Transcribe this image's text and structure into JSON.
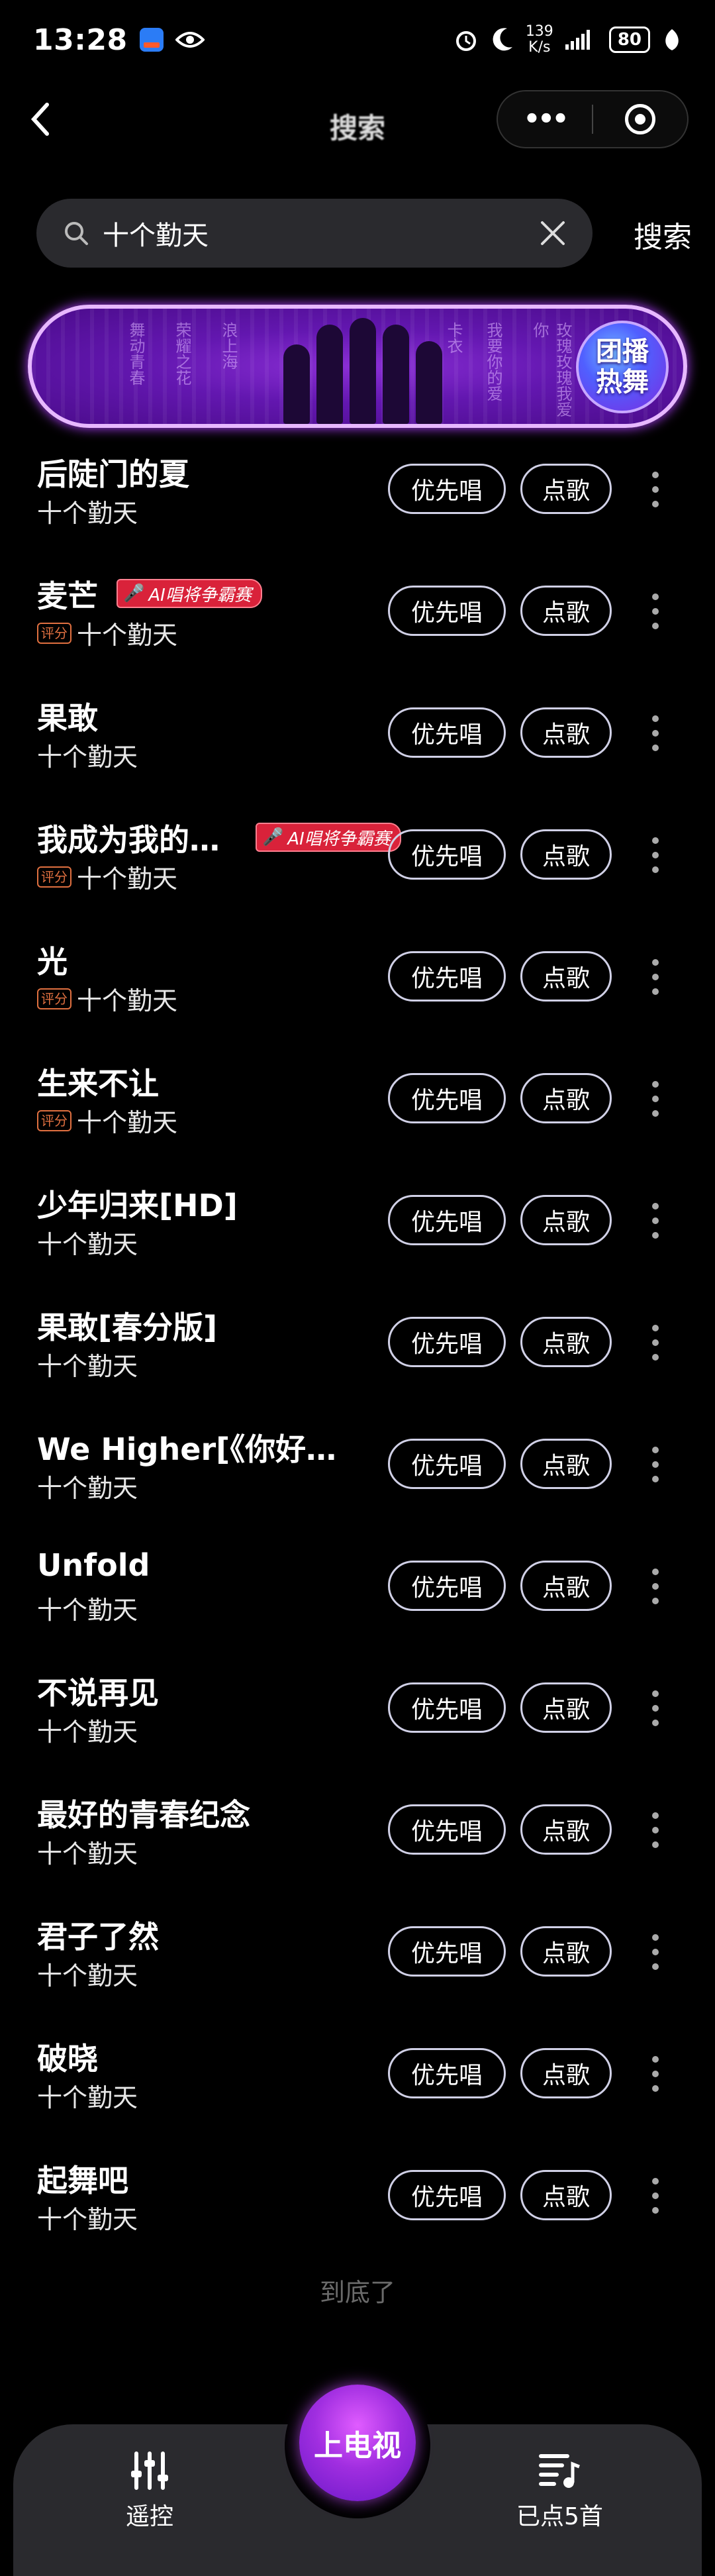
{
  "status_bar": {
    "time": "13:28",
    "speed_top": "139",
    "speed_bottom": "K/s",
    "battery": "80"
  },
  "nav": {
    "back_icon": "chevron-left-icon",
    "title": "搜索"
  },
  "search": {
    "query": "十个勤天",
    "button_label": "搜索"
  },
  "banner": {
    "badge_line1": "团播",
    "badge_line2": "热舞",
    "deco_texts": [
      "舞动青春",
      "荣耀之花",
      "浪上海",
      "卡衣",
      "我要你的爱",
      "玫瑰玫瑰我爱你"
    ]
  },
  "rate_tag_label": "评分",
  "ai_badge_label": "AI唱将争霸赛",
  "priority_label": "优先唱",
  "add_label": "点歌",
  "songs": [
    {
      "title": "后陡门的夏",
      "artist": "十个勤天",
      "rated": false,
      "ai": false
    },
    {
      "title": "麦芒",
      "artist": "十个勤天",
      "rated": true,
      "ai": true
    },
    {
      "title": "果敢",
      "artist": "十个勤天",
      "rated": false,
      "ai": false
    },
    {
      "title": "我成为我的…",
      "artist": "十个勤天",
      "rated": true,
      "ai": true
    },
    {
      "title": "光",
      "artist": "十个勤天",
      "rated": true,
      "ai": false
    },
    {
      "title": "生来不让",
      "artist": "十个勤天",
      "rated": true,
      "ai": false
    },
    {
      "title": "少年归来[HD]",
      "artist": "十个勤天",
      "rated": false,
      "ai": false
    },
    {
      "title": "果敢[春分版]",
      "artist": "十个勤天",
      "rated": false,
      "ai": false
    },
    {
      "title": "We Higher[《你好…",
      "artist": "十个勤天",
      "rated": false,
      "ai": false
    },
    {
      "title": "Unfold",
      "artist": "十个勤天",
      "rated": false,
      "ai": false
    },
    {
      "title": "不说再见",
      "artist": "十个勤天",
      "rated": false,
      "ai": false
    },
    {
      "title": "最好的青春纪念",
      "artist": "十个勤天",
      "rated": false,
      "ai": false
    },
    {
      "title": "君子了然",
      "artist": "十个勤天",
      "rated": false,
      "ai": false
    },
    {
      "title": "破晓",
      "artist": "十个勤天",
      "rated": false,
      "ai": false
    },
    {
      "title": "起舞吧",
      "artist": "十个勤天",
      "rated": false,
      "ai": false
    }
  ],
  "end_text": "到底了",
  "bottom_bar": {
    "remote_label": "遥控",
    "tv_label": "上电视",
    "queue_label": "已点5首"
  }
}
